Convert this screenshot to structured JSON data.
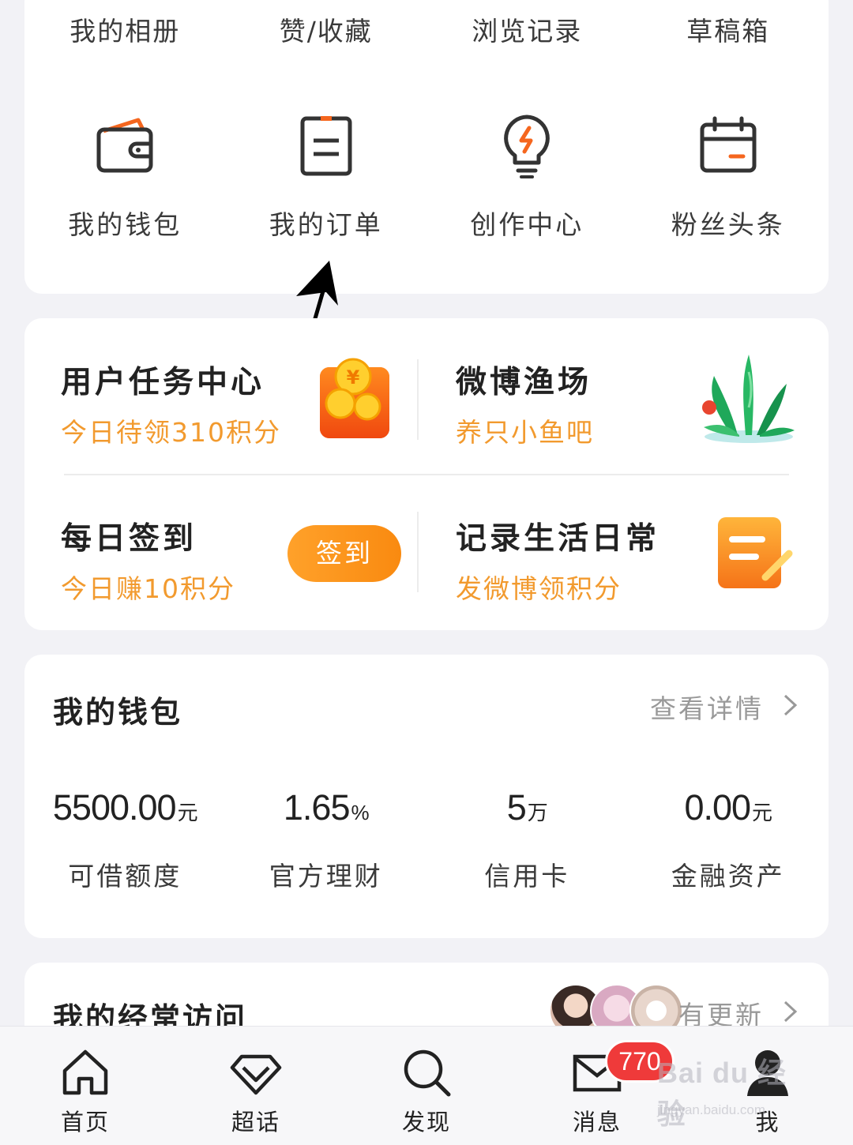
{
  "top_card": {
    "links": [
      "我的相册",
      "赞/收藏",
      "浏览记录",
      "草稿箱"
    ],
    "shortcuts": [
      {
        "label": "我的钱包",
        "icon": "wallet-icon"
      },
      {
        "label": "我的订单",
        "icon": "order-list-icon"
      },
      {
        "label": "创作中心",
        "icon": "lightbulb-icon"
      },
      {
        "label": "粉丝头条",
        "icon": "calendar-icon"
      }
    ]
  },
  "tasks": {
    "user_task": {
      "title": "用户任务中心",
      "subtitle": "今日待领310积分",
      "icon": "coin-pouch-icon"
    },
    "fish_farm": {
      "title": "微博渔场",
      "subtitle": "养只小鱼吧",
      "icon": "seaweed-icon"
    },
    "daily_sign": {
      "title": "每日签到",
      "subtitle": "今日赚10积分",
      "button": "签到"
    },
    "record_life": {
      "title": "记录生活日常",
      "subtitle": "发微博领积分",
      "icon": "note-pencil-icon"
    }
  },
  "wallet": {
    "title": "我的钱包",
    "more": "查看详情",
    "stats": [
      {
        "value": "5500.00",
        "unit": "元",
        "label": "可借额度"
      },
      {
        "value": "1.65",
        "unit": "%",
        "label": "官方理财"
      },
      {
        "value": "5",
        "unit": "万",
        "label": "信用卡"
      },
      {
        "value": "0.00",
        "unit": "元",
        "label": "金融资产"
      }
    ]
  },
  "frequent": {
    "title": "我的经常访问",
    "update": "有更新"
  },
  "bottom_nav": {
    "items": [
      {
        "label": "首页",
        "icon": "home-icon"
      },
      {
        "label": "超话",
        "icon": "diamond-icon"
      },
      {
        "label": "发现",
        "icon": "search-icon"
      },
      {
        "label": "消息",
        "icon": "mail-icon"
      },
      {
        "label": "我",
        "icon": "profile-icon"
      }
    ],
    "message_badge": "770"
  },
  "watermark": {
    "text": "Bai du 经验",
    "sub": "jingyan.baidu.com"
  },
  "colors": {
    "accent_orange": "#f29a2e",
    "icon_orange": "#f5661e",
    "badge_red": "#ef3a3a",
    "background": "#f2f2f6"
  }
}
